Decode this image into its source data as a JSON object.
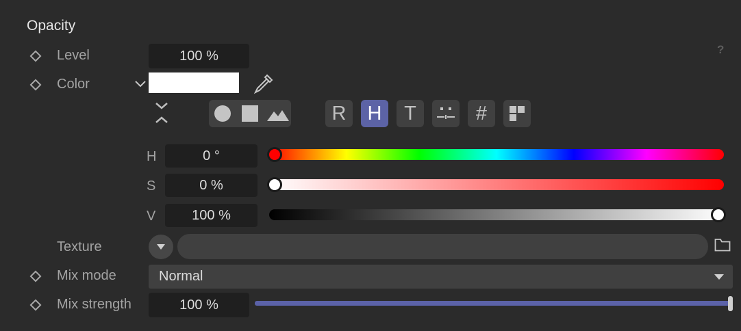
{
  "section": {
    "title": "Opacity",
    "help": "?"
  },
  "level": {
    "label": "Level",
    "value": "100 %"
  },
  "color": {
    "label": "Color",
    "swatch_color": "#ffffff"
  },
  "modes": {
    "r": "R",
    "h": "H",
    "t": "T",
    "hex": "#",
    "active": "H",
    "active_color": "#5c63a6"
  },
  "hsv": {
    "h": {
      "label": "H",
      "value": "0 °",
      "fraction": 0.0
    },
    "s": {
      "label": "S",
      "value": "0 %",
      "fraction": 0.0
    },
    "v": {
      "label": "V",
      "value": "100 %",
      "fraction": 1.0
    }
  },
  "texture": {
    "label": "Texture",
    "value": ""
  },
  "mix_mode": {
    "label": "Mix mode",
    "value": "Normal"
  },
  "mix_strength": {
    "label": "Mix strength",
    "value": "100 %",
    "fraction": 1.0
  }
}
